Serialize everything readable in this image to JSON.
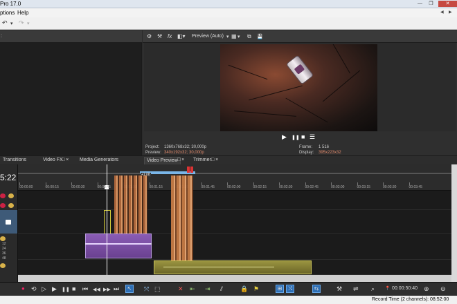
{
  "window": {
    "title": "Pro 17.0",
    "minimize_glyph": "—",
    "maximize_glyph": "❐",
    "close_glyph": "✕"
  },
  "menu": {
    "items": [
      "ptions",
      "Help"
    ],
    "scroll_left": "◀",
    "scroll_right": "▶"
  },
  "toolbar": {
    "undo_icon": "undo-icon",
    "undo_glyph": "↶",
    "dropdown_glyph": "▾",
    "redo_glyph": "↷"
  },
  "explorer": {
    "header_label": ":"
  },
  "preview": {
    "toolbar": {
      "settings_glyph": "⚙",
      "fx_label": "fx",
      "mode_label": "Preview (Auto)",
      "grid_glyph": "▦",
      "copy_glyph": "⧉",
      "save_glyph": "💾"
    },
    "transport": {
      "play": "▶",
      "pause": "❚❚",
      "stop": "■",
      "menu": "☰"
    },
    "info": {
      "project_label": "Project:",
      "project_value": "1360x768x32; 30,000p",
      "preview_label": "Preview:",
      "preview_value": "340x192x32; 30,000p",
      "frame_label": "Frame:",
      "frame_value": "1 516",
      "display_label": "Display:",
      "display_value": "395x223x32"
    }
  },
  "dock_tabs": {
    "transitions": "Transitions",
    "video_fx": "Video FX",
    "media_generators": "Media Generators",
    "video_preview": "Video Preview",
    "trimmer": "Trimmer",
    "tab_icons": "□ ×"
  },
  "timeline": {
    "timecode": "5:22",
    "ruler_labels": [
      "00:00:00",
      "00:00:15",
      "00:00:30",
      "00:00:45",
      "00:01:00",
      "00:01:15",
      "00:01:30",
      "00:01:45",
      "00:02:00",
      "00:02:15",
      "00:02:30",
      "00:02:45",
      "00:03:00",
      "00:03:15",
      "00:03:30",
      "00:03:45"
    ],
    "cursor_label": "+1:08",
    "meter_labels": [
      "12",
      "24",
      "36",
      "48"
    ]
  },
  "transport": {
    "record_glyph": "●",
    "loop_glyph": "⟲",
    "play_from_start": "▷",
    "play": "▶",
    "pause": "❚❚",
    "stop": "■",
    "prev_marker": "⏮",
    "prev_frame": "◀◀",
    "next_frame": "▶▶",
    "next_marker": "⏭",
    "time_readout": "00:00:50:40"
  },
  "status": {
    "record_time": "Record Time (2 channels): 08:52:00"
  },
  "colors": {
    "accent": "#2e6fb5",
    "clip_orange": "#d9844a",
    "clip_purple": "#7a4fa0",
    "clip_olive": "#8f8a3a",
    "warning_text": "#e38b6d"
  }
}
